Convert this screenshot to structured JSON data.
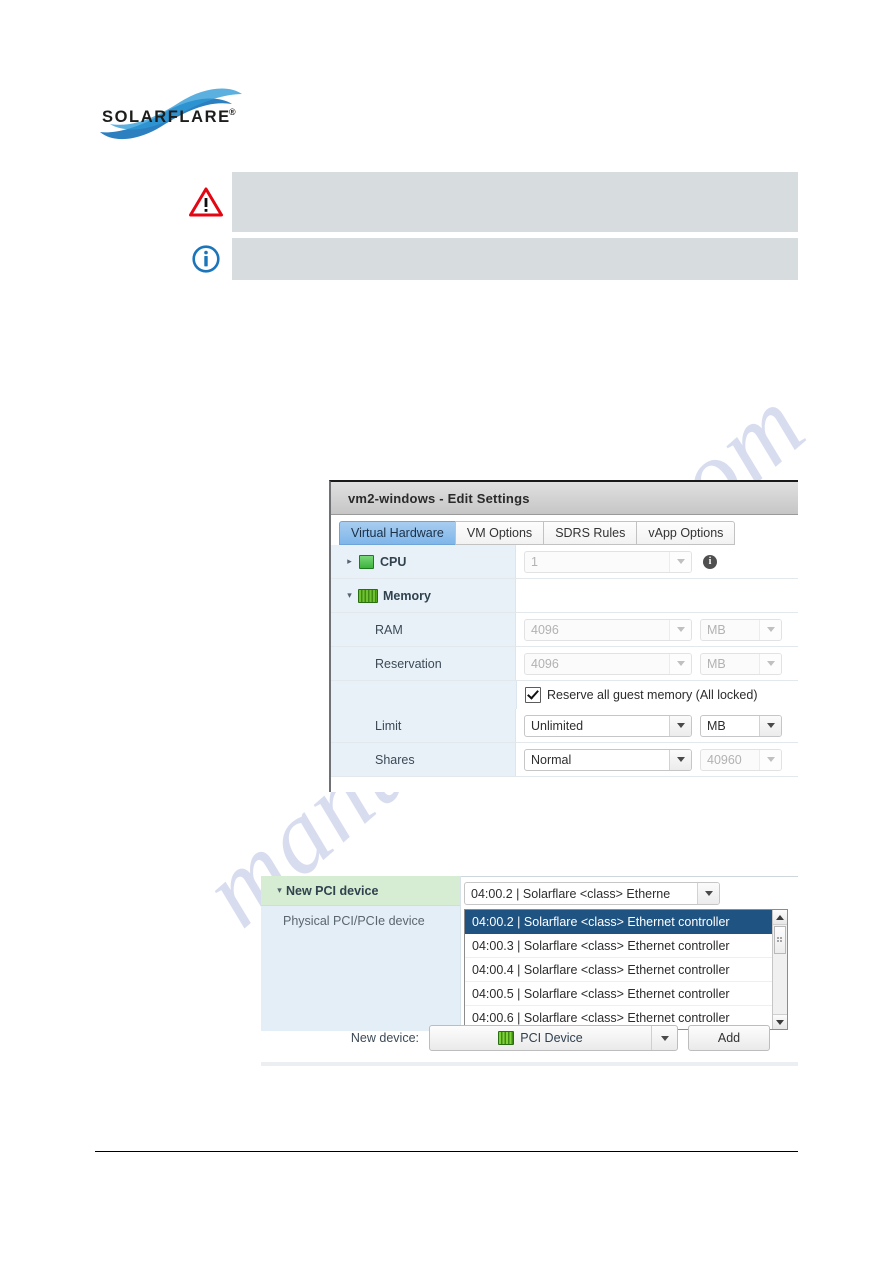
{
  "brand": {
    "logo_text": "SOLARFLARE",
    "logo_mark": "®",
    "accent_blue": "#1b75bb",
    "dark_blue": "#0b4f7f"
  },
  "watermark": {
    "text": "manualshive.com",
    "color": "#b9c0e2"
  },
  "notes": [
    {
      "icon": "warning-triangle-icon",
      "text": "",
      "box_color": "#d7dcdf",
      "icon_color": "#e30613"
    },
    {
      "icon": "info-circle-icon",
      "text": "",
      "box_color": "#d7dcdf",
      "icon_color": "#1b75bb"
    }
  ],
  "dialog": {
    "title": "vm2-windows - Edit Settings",
    "tabs": [
      {
        "label": "Virtual Hardware",
        "active": true
      },
      {
        "label": "VM Options",
        "active": false
      },
      {
        "label": "SDRS Rules",
        "active": false
      },
      {
        "label": "vApp Options",
        "active": false
      }
    ],
    "rows": {
      "cpu": {
        "label": "CPU",
        "twisty": "▸",
        "value": "1",
        "icon": "cpu-icon",
        "info_icon": "info-icon"
      },
      "memory": {
        "label": "Memory",
        "twisty": "▾",
        "icon": "memory-icon"
      },
      "ram": {
        "label": "RAM",
        "value": "4096",
        "unit": "MB"
      },
      "reservation": {
        "label": "Reservation",
        "value": "4096",
        "unit": "MB"
      },
      "reserve_all": {
        "label": "Reserve all guest memory (All locked)",
        "checked": true
      },
      "limit": {
        "label": "Limit",
        "value": "Unlimited",
        "unit": "MB"
      },
      "shares": {
        "label": "Shares",
        "value": "Normal",
        "unit": "40960"
      }
    }
  },
  "pci": {
    "group_label": "New PCI device",
    "group_twisty": "▾",
    "sub_label": "Physical PCI/PCIe device",
    "combo_value": "04:00.2 | Solarflare <class> Etherne",
    "options": [
      "04:00.2 | Solarflare <class> Ethernet controller",
      "04:00.3 | Solarflare <class> Ethernet controller",
      "04:00.4 | Solarflare <class> Ethernet controller",
      "04:00.5 | Solarflare <class> Ethernet controller",
      "04:00.6 | Solarflare <class> Ethernet controller"
    ],
    "selected_index": 0,
    "new_device_label": "New device:",
    "new_device_value": "PCI Device",
    "add_button": "Add"
  }
}
